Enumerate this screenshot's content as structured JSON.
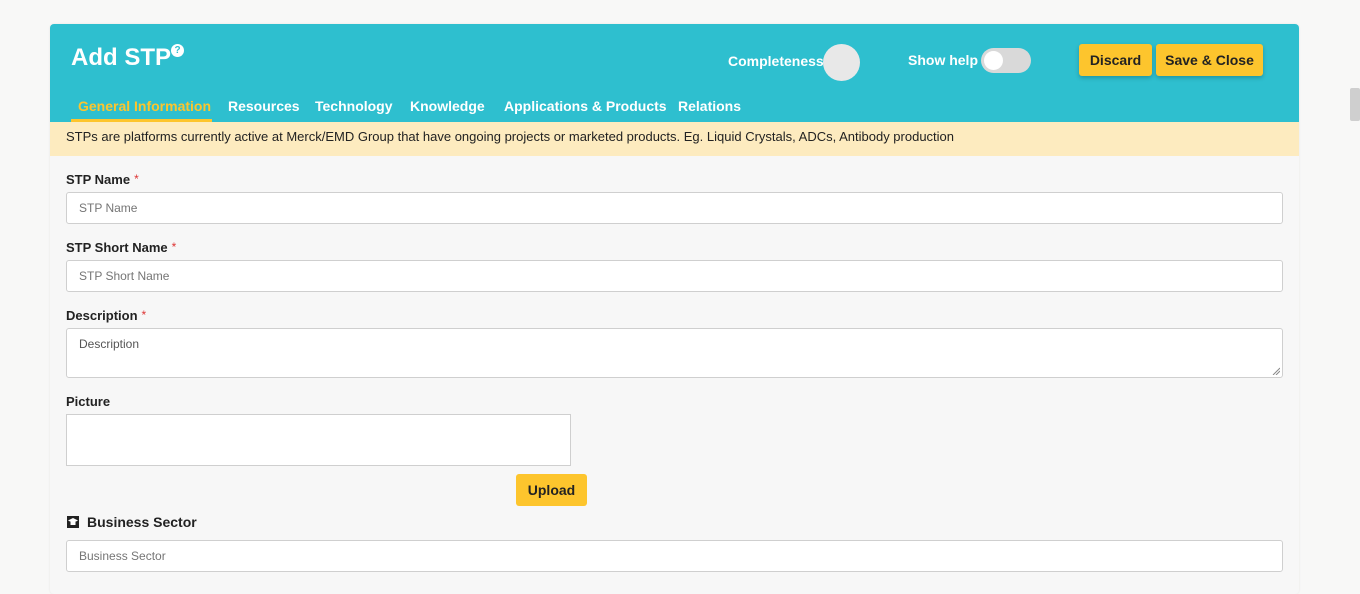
{
  "header": {
    "title": "Add STP",
    "help_icon_glyph": "?",
    "completeness_label": "Completeness",
    "show_help_label": "Show help",
    "show_help_enabled": false,
    "discard_label": "Discard",
    "save_close_label": "Save & Close",
    "accent_color": "#2ebfcf",
    "button_color": "#fdc52d"
  },
  "tabs": [
    {
      "label": "General Information",
      "active": true
    },
    {
      "label": "Resources",
      "active": false
    },
    {
      "label": "Technology",
      "active": false
    },
    {
      "label": "Knowledge",
      "active": false
    },
    {
      "label": "Applications & Products",
      "active": false
    },
    {
      "label": "Relations",
      "active": false
    }
  ],
  "info_text": "STPs are platforms currently active at Merck/EMD Group that have ongoing projects or marketed products. Eg. Liquid Crystals, ADCs, Antibody production",
  "form": {
    "stp_name": {
      "label": "STP Name",
      "required_mark": "*",
      "placeholder": "STP Name",
      "value": ""
    },
    "stp_short_name": {
      "label": "STP Short Name",
      "required_mark": "*",
      "placeholder": "STP Short Name",
      "value": ""
    },
    "description": {
      "label": "Description",
      "required_mark": "*",
      "placeholder": "Description",
      "value": ""
    },
    "picture": {
      "label": "Picture",
      "upload_label": "Upload"
    },
    "business_sector": {
      "label": "Business Sector",
      "icon": "graduation-cap-icon",
      "placeholder": "Business Sector",
      "value": ""
    }
  }
}
